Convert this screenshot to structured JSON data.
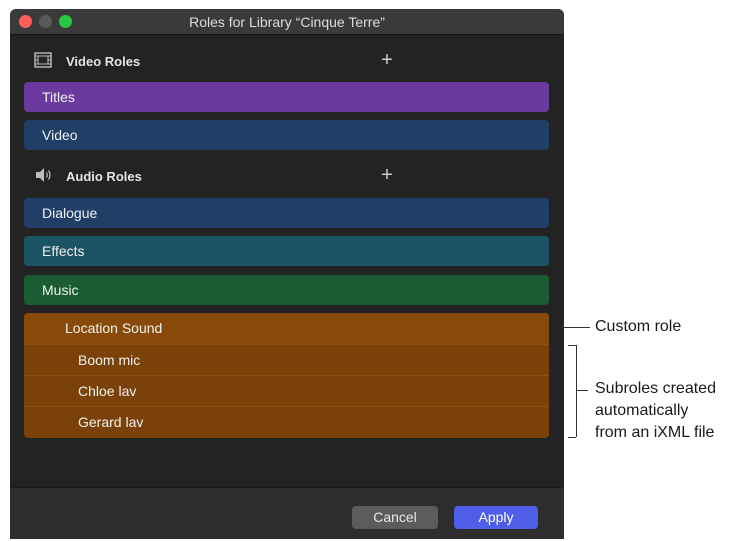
{
  "window": {
    "title": "Roles for Library “Cinque Terre”"
  },
  "video_section": {
    "label": "Video Roles",
    "icon": "film-icon",
    "add_label": "+",
    "roles": [
      {
        "label": "Titles",
        "color": "#6a3a9e"
      },
      {
        "label": "Video",
        "color": "#1f3f66"
      }
    ]
  },
  "audio_section": {
    "label": "Audio Roles",
    "icon": "speaker-icon",
    "add_label": "+",
    "roles": [
      {
        "label": "Dialogue",
        "color": "#213e66"
      },
      {
        "label": "Effects",
        "color": "#1d5465"
      },
      {
        "label": "Music",
        "color": "#1c5c33"
      }
    ],
    "custom_role": {
      "label": "Location Sound",
      "color": "#874a09",
      "subroles": [
        {
          "label": "Boom mic"
        },
        {
          "label": "Chloe lav"
        },
        {
          "label": "Gerard lav"
        }
      ]
    }
  },
  "footer": {
    "cancel_label": "Cancel",
    "apply_label": "Apply"
  },
  "callouts": {
    "custom_role": "Custom role",
    "subroles_line1": "Subroles created",
    "subroles_line2": "automatically",
    "subroles_line3": "from an iXML file"
  }
}
